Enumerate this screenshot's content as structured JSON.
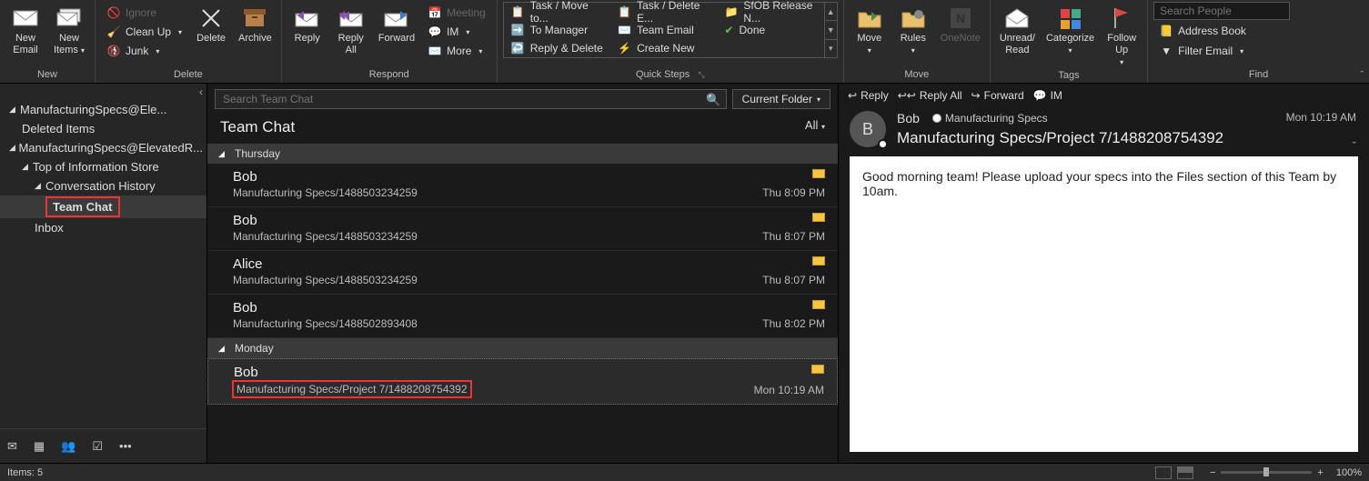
{
  "ribbon": {
    "new": {
      "label": "New",
      "new_email": "New\nEmail",
      "new_items": "New\nItems"
    },
    "delete": {
      "label": "Delete",
      "ignore": "Ignore",
      "cleanup": "Clean Up",
      "junk": "Junk",
      "delete_btn": "Delete",
      "archive": "Archive"
    },
    "respond": {
      "label": "Respond",
      "reply": "Reply",
      "reply_all": "Reply\nAll",
      "forward": "Forward",
      "meeting": "Meeting",
      "im": "IM",
      "more": "More"
    },
    "quicksteps": {
      "label": "Quick Steps",
      "items": [
        "Task / Move to...",
        "Task / Delete E...",
        "SfOB Release N...",
        "To Manager",
        "Team Email",
        "Done",
        "Reply & Delete",
        "Create New"
      ]
    },
    "move": {
      "label": "Move",
      "move_btn": "Move",
      "rules": "Rules",
      "onenote": "OneNote"
    },
    "tags": {
      "label": "Tags",
      "unread": "Unread/\nRead",
      "categorize": "Categorize",
      "followup": "Follow\nUp"
    },
    "find": {
      "label": "Find",
      "search_placeholder": "Search People",
      "address_book": "Address Book",
      "filter_email": "Filter Email"
    }
  },
  "nav": {
    "account": "ManufacturingSpecs@Ele...",
    "deleted": "Deleted Items",
    "account2": "ManufacturingSpecs@ElevatedR...",
    "top_store": "Top of Information Store",
    "conv_hist": "Conversation History",
    "team_chat": "Team Chat",
    "inbox": "Inbox"
  },
  "list": {
    "search_placeholder": "Search Team Chat",
    "scope": "Current Folder",
    "folder": "Team Chat",
    "filter": "All",
    "groups": [
      {
        "label": "Thursday",
        "msgs": [
          {
            "from": "Bob",
            "subj": "Manufacturing Specs/1488503234259",
            "time": "Thu 8:09 PM"
          },
          {
            "from": "Bob",
            "subj": "Manufacturing Specs/1488503234259",
            "time": "Thu 8:07 PM"
          },
          {
            "from": "Alice",
            "subj": "Manufacturing Specs/1488503234259",
            "time": "Thu 8:07 PM"
          },
          {
            "from": "Bob",
            "subj": "Manufacturing Specs/1488502893408",
            "time": "Thu 8:02 PM"
          }
        ]
      },
      {
        "label": "Monday",
        "msgs": [
          {
            "from": "Bob",
            "subj": "Manufacturing Specs/Project 7/1488208754392",
            "time": "Mon 10:19 AM",
            "selected": true
          }
        ]
      }
    ]
  },
  "read": {
    "actions": {
      "reply": "Reply",
      "reply_all": "Reply All",
      "forward": "Forward",
      "im": "IM"
    },
    "from": "Bob",
    "avatar_initial": "B",
    "category": "Manufacturing Specs",
    "time": "Mon 10:19 AM",
    "subject": "Manufacturing Specs/Project 7/1488208754392",
    "body": "Good morning team! Please upload your specs into the Files section of this Team by 10am."
  },
  "status": {
    "items": "Items: 5",
    "zoom": "100%"
  }
}
